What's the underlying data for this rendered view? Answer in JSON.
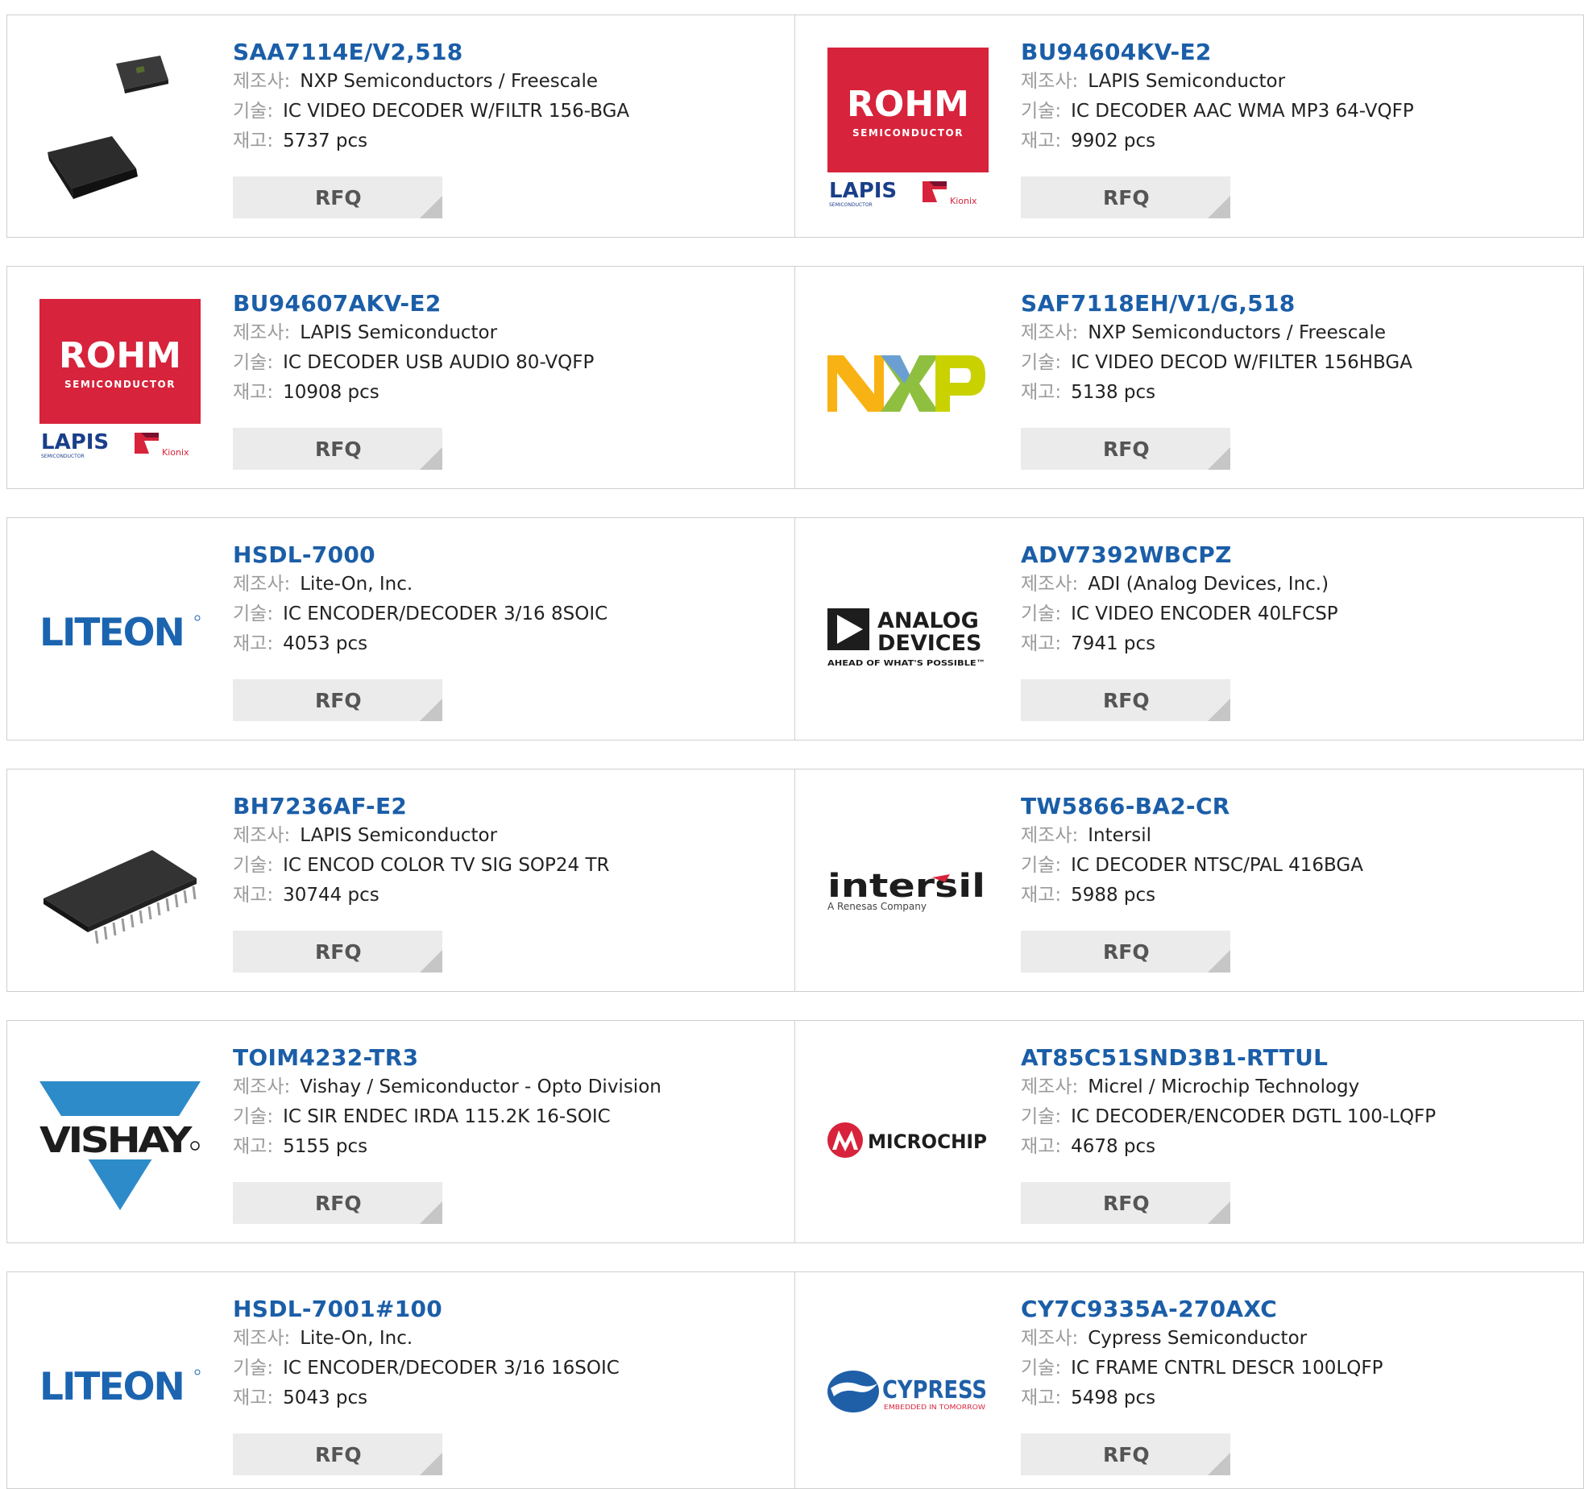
{
  "labels": {
    "manufacturer": "제조사:",
    "description": "기술:",
    "stock": "재고:",
    "rfq": "RFQ"
  },
  "logo_text": {
    "rohm": "ROHM",
    "rohm_sub": "SEMICONDUCTOR",
    "lapis": "LAPIS",
    "lapis_sub": "SEMICONDUCTOR",
    "kionix": "Kionix",
    "nxp": "NXP",
    "liteon": "LITEON",
    "adi_1": "ANALOG",
    "adi_2": "DEVICES",
    "adi_tag": "AHEAD OF WHAT'S POSSIBLE™",
    "intersil": "intersil",
    "intersil_sub": "A Renesas Company",
    "vishay": "VISHAY",
    "microchip": "MICROCHIP",
    "cypress": "CYPRESS",
    "cypress_sub": "EMBEDDED IN TOMORROW"
  },
  "products": [
    {
      "part": "SAA7114E/V2,518",
      "manufacturer": "NXP Semiconductors / Freescale",
      "description": "IC VIDEO DECODER W/FILTR 156-BGA",
      "stock": "5737 pcs",
      "logo": "bga-chip-photo"
    },
    {
      "part": "BU94604KV-E2",
      "manufacturer": "LAPIS Semiconductor",
      "description": "IC DECODER AAC WMA MP3 64-VQFP",
      "stock": "9902 pcs",
      "logo": "rohm-lapis-logo"
    },
    {
      "part": "BU94607AKV-E2",
      "manufacturer": "LAPIS Semiconductor",
      "description": "IC DECODER USB AUDIO 80-VQFP",
      "stock": "10908 pcs",
      "logo": "rohm-lapis-logo"
    },
    {
      "part": "SAF7118EH/V1/G,518",
      "manufacturer": "NXP Semiconductors / Freescale",
      "description": "IC VIDEO DECOD W/FILTER 156HBGA",
      "stock": "5138 pcs",
      "logo": "nxp-logo"
    },
    {
      "part": "HSDL-7000",
      "manufacturer": "Lite-On, Inc.",
      "description": "IC ENCODER/DECODER 3/16 8SOIC",
      "stock": "4053 pcs",
      "logo": "liteon-logo"
    },
    {
      "part": "ADV7392WBCPZ",
      "manufacturer": "ADI (Analog Devices, Inc.)",
      "description": "IC VIDEO ENCODER 40LFCSP",
      "stock": "7941 pcs",
      "logo": "analog-devices-logo"
    },
    {
      "part": "BH7236AF-E2",
      "manufacturer": "LAPIS Semiconductor",
      "description": "IC ENCOD COLOR TV SIG SOP24 TR",
      "stock": "30744 pcs",
      "logo": "sop-chip-photo"
    },
    {
      "part": "TW5866-BA2-CR",
      "manufacturer": "Intersil",
      "description": "IC DECODER NTSC/PAL 416BGA",
      "stock": "5988 pcs",
      "logo": "intersil-logo"
    },
    {
      "part": "TOIM4232-TR3",
      "manufacturer": "Vishay / Semiconductor - Opto Division",
      "description": "IC SIR ENDEC IRDA 115.2K 16-SOIC",
      "stock": "5155 pcs",
      "logo": "vishay-logo"
    },
    {
      "part": "AT85C51SND3B1-RTTUL",
      "manufacturer": "Micrel / Microchip Technology",
      "description": "IC DECODER/ENCODER DGTL 100-LQFP",
      "stock": "4678 pcs",
      "logo": "microchip-logo"
    },
    {
      "part": "HSDL-7001#100",
      "manufacturer": "Lite-On, Inc.",
      "description": "IC ENCODER/DECODER 3/16 16SOIC",
      "stock": "5043 pcs",
      "logo": "liteon-logo"
    },
    {
      "part": "CY7C9335A-270AXC",
      "manufacturer": "Cypress Semiconductor",
      "description": "IC FRAME CNTRL DESCR 100LQFP",
      "stock": "5498 pcs",
      "logo": "cypress-logo"
    }
  ]
}
